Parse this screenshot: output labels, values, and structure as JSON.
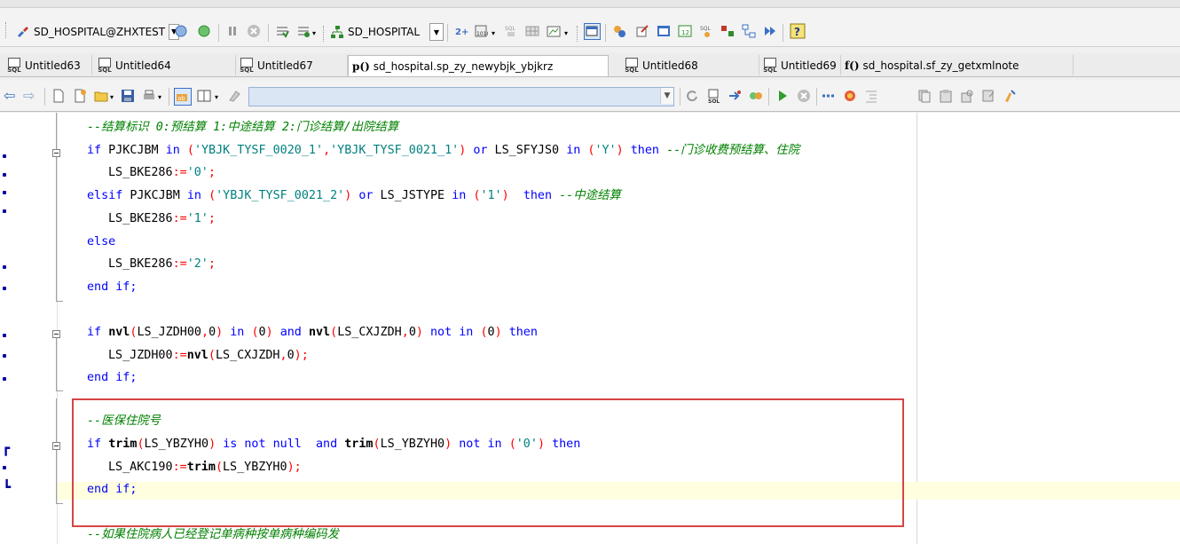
{
  "toolbar": {
    "connection": "SD_HOSPITAL@ZHXTEST",
    "schema": "SD_HOSPITAL",
    "object_search_value": ""
  },
  "tabs": [
    {
      "label": "Untitled63",
      "type": "sql"
    },
    {
      "label": "Untitled64",
      "type": "sql"
    },
    {
      "label": "Untitled67",
      "type": "sql"
    },
    {
      "label": "sd_hospital.sp_zy_newybjk_ybjkrz",
      "type": "procedure",
      "icon_text": "p()",
      "active": true
    },
    {
      "label": "Untitled68",
      "type": "sql"
    },
    {
      "label": "Untitled69",
      "type": "sql"
    },
    {
      "label": "sd_hospital.sf_zy_getxmlnote",
      "type": "function",
      "icon_text": "f()"
    }
  ],
  "editor": {
    "lines": [
      "--结算标识 0:预结算 1:中途结算 2:门诊结算/出院结算",
      "if PJKCJBM in ('YBJK_TYSF_0020_1','YBJK_TYSF_0021_1') or LS_SFYJS0 in ('Y') then --门诊收费预结算、住院",
      "LS_BKE286:='0';",
      "elsif PJKCJBM in ('YBJK_TYSF_0021_2') or LS_JSTYPE in ('1')  then --中途结算",
      "LS_BKE286:='1';",
      "else",
      "LS_BKE286:='2';",
      "end if;",
      "",
      "if nvl(LS_JZDH00,0) in (0) and nvl(LS_CXJZDH,0) not in (0) then",
      "LS_JZDH00:=nvl(LS_CXJZDH,0);",
      "end if;",
      "",
      "--医保住院号",
      "if trim(LS_YBZYH0) is not null  and trim(LS_YBZYH0) not in ('0') then",
      "LS_AKC190:=trim(LS_YBZYH0);",
      "end if;",
      "",
      "--如果住院病人已经登记单病种按单病种编码发"
    ]
  }
}
